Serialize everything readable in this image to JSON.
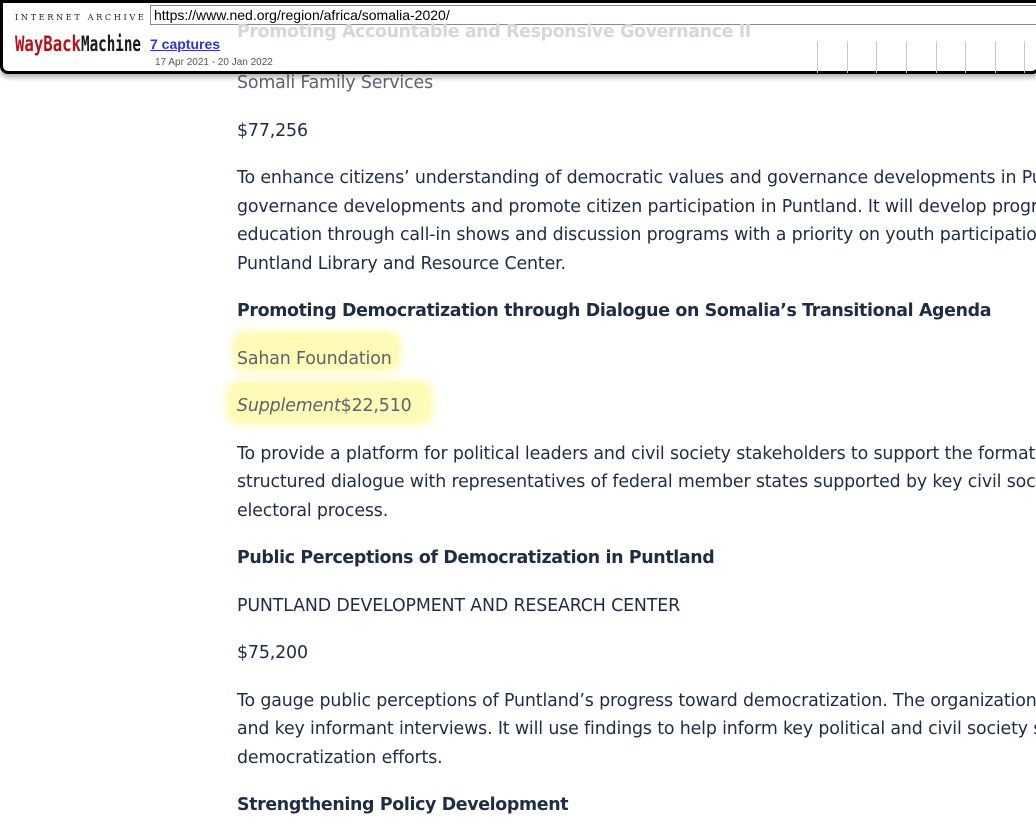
{
  "wayback": {
    "logo_top_text": "INTERNET ARCHIVE",
    "logo_text": "WayBackMachine",
    "url": "https://www.ned.org/region/africa/somalia-2020/",
    "captures": "7 captures",
    "date_range": "17 Apr 2021 - 20 Jan 2022",
    "colors": {
      "logo_red": "#b5121b",
      "link": "#3333cc"
    }
  },
  "article": {
    "ghost_heading": "Promoting Accountable and Responsive Governance II",
    "grants": [
      {
        "org": "Somali Family Services",
        "amount": "$77,256",
        "description": [
          "To enhance citizens’ understanding of democratic values and governance developments in Puntlar",
          "governance developments and promote citizen participation in Puntland. It will develop programm",
          "education through call-in shows and discussion programs with a priority on youth participation in",
          "Puntland Library and Resource Center."
        ]
      },
      {
        "title": "Promoting Democratization through Dialogue on Somalia’s Transitional Agenda",
        "org": "Sahan Foundation",
        "amount_prefix": "Supplement",
        "amount": "$22,510",
        "description": [
          "To provide a platform for political leaders and civil society stakeholders to support the formation o",
          "structured dialogue with representatives of federal member states supported by key civil society t",
          "electoral process."
        ]
      },
      {
        "title": "Public Perceptions of Democratization in Puntland",
        "org": "PUNTLAND DEVELOPMENT AND RESEARCH CENTER",
        "amount": "$75,200",
        "description": [
          "To gauge public perceptions of Puntland’s progress toward democratization. The organization will",
          "and key informant interviews. It will use findings to help inform key political and civil society stake",
          "democratization efforts."
        ]
      },
      {
        "title": "Strengthening Policy Development"
      }
    ],
    "colors": {
      "text": "#1f2d44",
      "highlight": "#fff678"
    }
  }
}
